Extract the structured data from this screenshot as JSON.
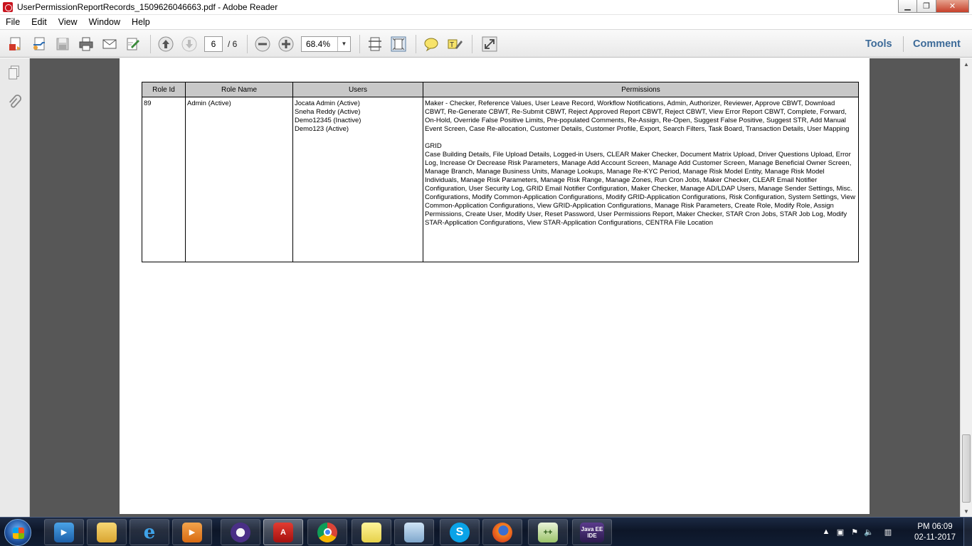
{
  "window": {
    "title": "UserPermissionReportRecords_1509626046663.pdf - Adobe Reader",
    "minimize_label": "▁",
    "maximize_label": "❐",
    "close_label": "✕"
  },
  "menu": [
    "File",
    "Edit",
    "View",
    "Window",
    "Help"
  ],
  "toolbar": {
    "current_page": "6",
    "page_total": "/ 6",
    "zoom": "68.4%",
    "tools_label": "Tools",
    "comment_label": "Comment"
  },
  "report": {
    "headers": [
      "Role Id",
      "Role Name",
      "Users",
      "Permissions"
    ],
    "row": {
      "role_id": "89",
      "role_name": "Admin (Active)",
      "users": [
        "Jocata Admin (Active)",
        "Sneha Reddy (Active)",
        "Demo12345 (Inactive)",
        "Demo123 (Active)"
      ],
      "permissions_main": "Maker - Checker, Reference Values, User Leave Record, Workflow Notifications, Admin, Authorizer, Reviewer, Approve CBWT, Download CBWT, Re-Generate CBWT, Re-Submit CBWT, Reject Approved Report CBWT, Reject CBWT, View Error Report CBWT, Complete, Forward, On-Hold, Override False Positive Limits, Pre-populated Comments, Re-Assign, Re-Open, Suggest False Positive, Suggest STR, Add Manual Event Screen, Case Re-allocation, Customer Details, Customer Profile, Export, Search Filters, Task Board, Transaction Details, User Mapping",
      "grid_heading": "GRID",
      "permissions_grid": "Case Building Details, File Upload Details, Logged-in Users, CLEAR Maker Checker, Document Matrix Upload, Driver Questions Upload, Error Log, Increase Or Decrease Risk Parameters, Manage Add Account Screen, Manage Add Customer Screen, Manage Beneficial Owner Screen, Manage Branch, Manage Business Units, Manage Lookups, Manage Re-KYC Period, Manage Risk Model Entity, Manage Risk Model Individuals, Manage Risk Parameters, Manage Risk Range, Manage Zones, Run Cron Jobs, Maker Checker, CLEAR Email Notifier Configuration, User Security Log, GRID Email Notifier Configuration, Maker Checker, Manage AD/LDAP Users, Manage Sender Settings, Misc. Configurations, Modify Common-Application Configurations, Modify GRID-Application Configurations, Risk Configuration, System Settings, View Common-Application Configurations, View GRID-Application Configurations, Manage Risk Parameters, Create Role, Modify Role, Assign Permissions, Create User, Modify User, Reset Password, User Permissions Report, Maker Checker, STAR Cron Jobs, STAR Job Log, Modify STAR-Application Configurations, View STAR-Application Configurations, CENTRA File Location"
    }
  },
  "taskbar": {
    "clock_time": "PM 06:09",
    "clock_date": "02-11-2017",
    "java_label": "Java EE IDE"
  },
  "colors": {
    "doc_bg": "#575757",
    "table_header_bg": "#c8c8c8",
    "link_blue": "#3c6a98",
    "taskbar_bg": "#0d1628"
  }
}
